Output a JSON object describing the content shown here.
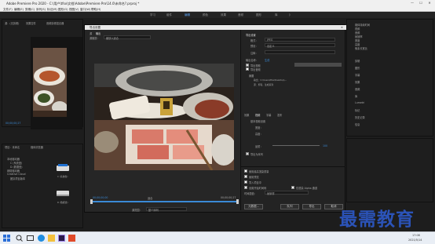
{
  "window": {
    "title": "Adobe Premiere Pro 2020 - C:\\用户\\tfsx\\文档\\Adobe\\Premiere Pro\\14.0\\未命名?.prproj *",
    "controls": [
      "—",
      "☐",
      "✕"
    ]
  },
  "menu": [
    "文件(F)",
    "编辑(E)",
    "剪辑(C)",
    "序列(S)",
    "标记(M)",
    "图形(G)",
    "视图(V)",
    "窗口(W)",
    "帮助(H)"
  ],
  "workspaces": [
    "学习",
    "组件",
    "编辑",
    "颜色",
    "效果",
    "音频",
    "图形",
    "库",
    "》"
  ],
  "left_panel": {
    "tabs": [
      "源：(无剪辑)",
      "效果控件",
      "音频剪辑混合器"
    ],
    "timecode": "00;00;00;27",
    "project_tabs": [
      "项目：未命名",
      "媒体浏览器"
    ],
    "tree": [
      "本地驱动器",
      "C (系统盘)",
      "D (数据盘)",
      "网络驱动器",
      "Creative Cloud",
      "团队项目版本"
    ],
    "thumb_labels": [
      "C (系统盘)",
      "D (数据盘)"
    ]
  },
  "dialog": {
    "title": "导出设置",
    "tabs": [
      "源",
      "输出"
    ],
    "source_scaling_label": "源缩放：",
    "source_scaling_value": "缩放以适合",
    "settings_header": "导出设置",
    "format_label": "格式：",
    "format_value": "JPEG",
    "preset_label": "预设：",
    "preset_value": "自定义",
    "comment_label": "注释：",
    "output_name_label": "输出名称：",
    "output_name_value": "生成",
    "export_video_label": "导出视频",
    "export_audio_label": "导出音频",
    "summary_label": "摘要",
    "summary_output": "输出：C:\\Users\\tfsx\\Desktop\\...",
    "summary_source": "源：剪辑，生成系列",
    "tabs2": [
      "效果",
      "视频",
      "字幕",
      "发布"
    ],
    "video_label": "基本视频设置",
    "width_label": "宽度：",
    "height_label": "高度：",
    "quality_label": "品质：",
    "quality_value": "100",
    "export_seq_label": "导出为序列",
    "options": [
      "使用最高渲染质量",
      "使用预览",
      "导入项目中",
      "设置开始时间码",
      "仅渲染 Alpha 通道"
    ],
    "time_interp_label": "时间插值：",
    "time_interp_value": "帧采样",
    "timecode_start": "00;00;00;00",
    "timecode_end": "00;00;00;27",
    "fit_label": "适合",
    "range_label": "源范围：",
    "range_value": "整个序列",
    "buttons": {
      "metadata": "元数据...",
      "queue": "队列",
      "export": "导出",
      "cancel": "取消"
    }
  },
  "right_panel": {
    "lines": [
      "媒体持续时间",
      "视频",
      "音频",
      "帧速率",
      "宽度",
      "高度",
      "像素长宽比",
      "文件名"
    ],
    "side_items": [
      "剪辑",
      "图形",
      "字幕",
      "效果",
      "音频",
      "库",
      "Lumetri",
      "标记",
      "历史记录",
      "信息"
    ]
  },
  "taskbar": {
    "time": "17:08",
    "date": "2021/5/14",
    "icons": [
      "start-icon",
      "search-icon",
      "taskview-icon",
      "edge-icon",
      "explorer-icon",
      "premiere-icon",
      "store-icon"
    ]
  },
  "watermark": "最需教育",
  "colors": {
    "accent": "#2d8ceb",
    "timeline": "#3a8ad6",
    "watermark": "#2b53b8"
  }
}
